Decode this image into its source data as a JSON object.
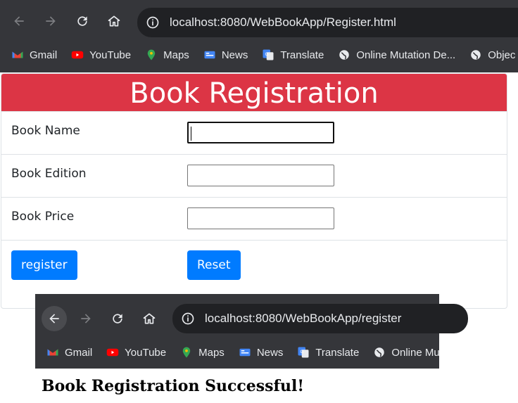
{
  "browser_top": {
    "url": "localhost:8080/WebBookApp/Register.html",
    "bookmarks": [
      {
        "icon": "gmail-icon",
        "label": "Gmail"
      },
      {
        "icon": "youtube-icon",
        "label": "YouTube"
      },
      {
        "icon": "maps-icon",
        "label": "Maps"
      },
      {
        "icon": "news-icon",
        "label": "News"
      },
      {
        "icon": "translate-icon",
        "label": "Translate"
      },
      {
        "icon": "globe-icon",
        "label": "Online Mutation De..."
      },
      {
        "icon": "globe-icon",
        "label": "Objec"
      }
    ]
  },
  "form": {
    "title": "Book Registration",
    "fields": [
      {
        "label": "Book Name",
        "value": ""
      },
      {
        "label": "Book Edition",
        "value": ""
      },
      {
        "label": "Book Price",
        "value": ""
      }
    ],
    "register_label": "register",
    "reset_label": "Reset",
    "accent_color": "#dc3545",
    "button_color": "#007bff"
  },
  "browser_bottom": {
    "url": "localhost:8080/WebBookApp/register",
    "bookmarks": [
      {
        "icon": "gmail-icon",
        "label": "Gmail"
      },
      {
        "icon": "youtube-icon",
        "label": "YouTube"
      },
      {
        "icon": "maps-icon",
        "label": "Maps"
      },
      {
        "icon": "news-icon",
        "label": "News"
      },
      {
        "icon": "translate-icon",
        "label": "Translate"
      },
      {
        "icon": "globe-icon",
        "label": "Online Mu"
      }
    ]
  },
  "result": {
    "message": "Book Registration Successful!"
  }
}
